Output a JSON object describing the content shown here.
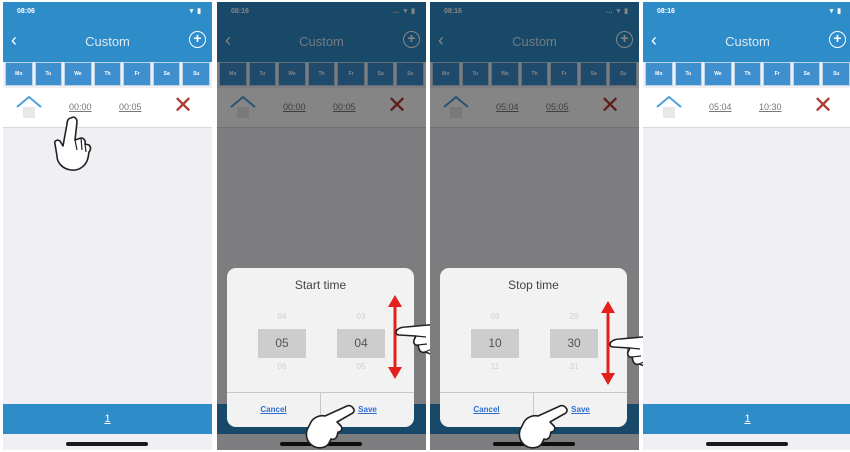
{
  "colors": {
    "brand": "#2e8cc9",
    "delete": "#b33a32",
    "link": "#2f6fd0"
  },
  "icons": {
    "back": "‹",
    "add": "+",
    "delete": "✕",
    "home": "house-icon",
    "hand": "pointing-hand-icon",
    "arrow": "up-down-arrow-icon"
  },
  "panels": [
    {
      "status_time": "08:06",
      "status_icons": "▾ ▮",
      "title": "Custom",
      "days": [
        "Mo",
        "Tu",
        "We",
        "Th",
        "Fr",
        "Sa",
        "Su"
      ],
      "start": "00:00",
      "stop": "00:05",
      "page": "1"
    },
    {
      "status_time": "08:16",
      "status_icons": "… ▾ ▮",
      "title": "Custom",
      "days": [
        "Mo",
        "Tu",
        "We",
        "Th",
        "Fr",
        "Sa",
        "Su"
      ],
      "start": "00:00",
      "stop": "00:05",
      "page": "1",
      "dialog": {
        "title": "Start time",
        "wheel1": {
          "above": "04",
          "selected": "05",
          "below": "06"
        },
        "wheel2": {
          "above": "03",
          "selected": "04",
          "below": "05"
        },
        "cancel": "Cancel",
        "save": "Save"
      }
    },
    {
      "status_time": "08:16",
      "status_icons": "… ▾ ▮",
      "title": "Custom",
      "days": [
        "Mo",
        "Tu",
        "We",
        "Th",
        "Fr",
        "Sa",
        "Su"
      ],
      "start": "05:04",
      "stop": "05:05",
      "page": "1",
      "dialog": {
        "title": "Stop time",
        "wheel1": {
          "above": "09",
          "selected": "10",
          "below": "11"
        },
        "wheel2": {
          "above": "29",
          "selected": "30",
          "below": "31"
        },
        "cancel": "Cancel",
        "save": "Save"
      }
    },
    {
      "status_time": "08:16",
      "status_icons": "▾ ▮",
      "title": "Custom",
      "days": [
        "Mo",
        "Tu",
        "We",
        "Th",
        "Fr",
        "Sa",
        "Su"
      ],
      "start": "05:04",
      "stop": "10:30",
      "page": "1"
    }
  ]
}
